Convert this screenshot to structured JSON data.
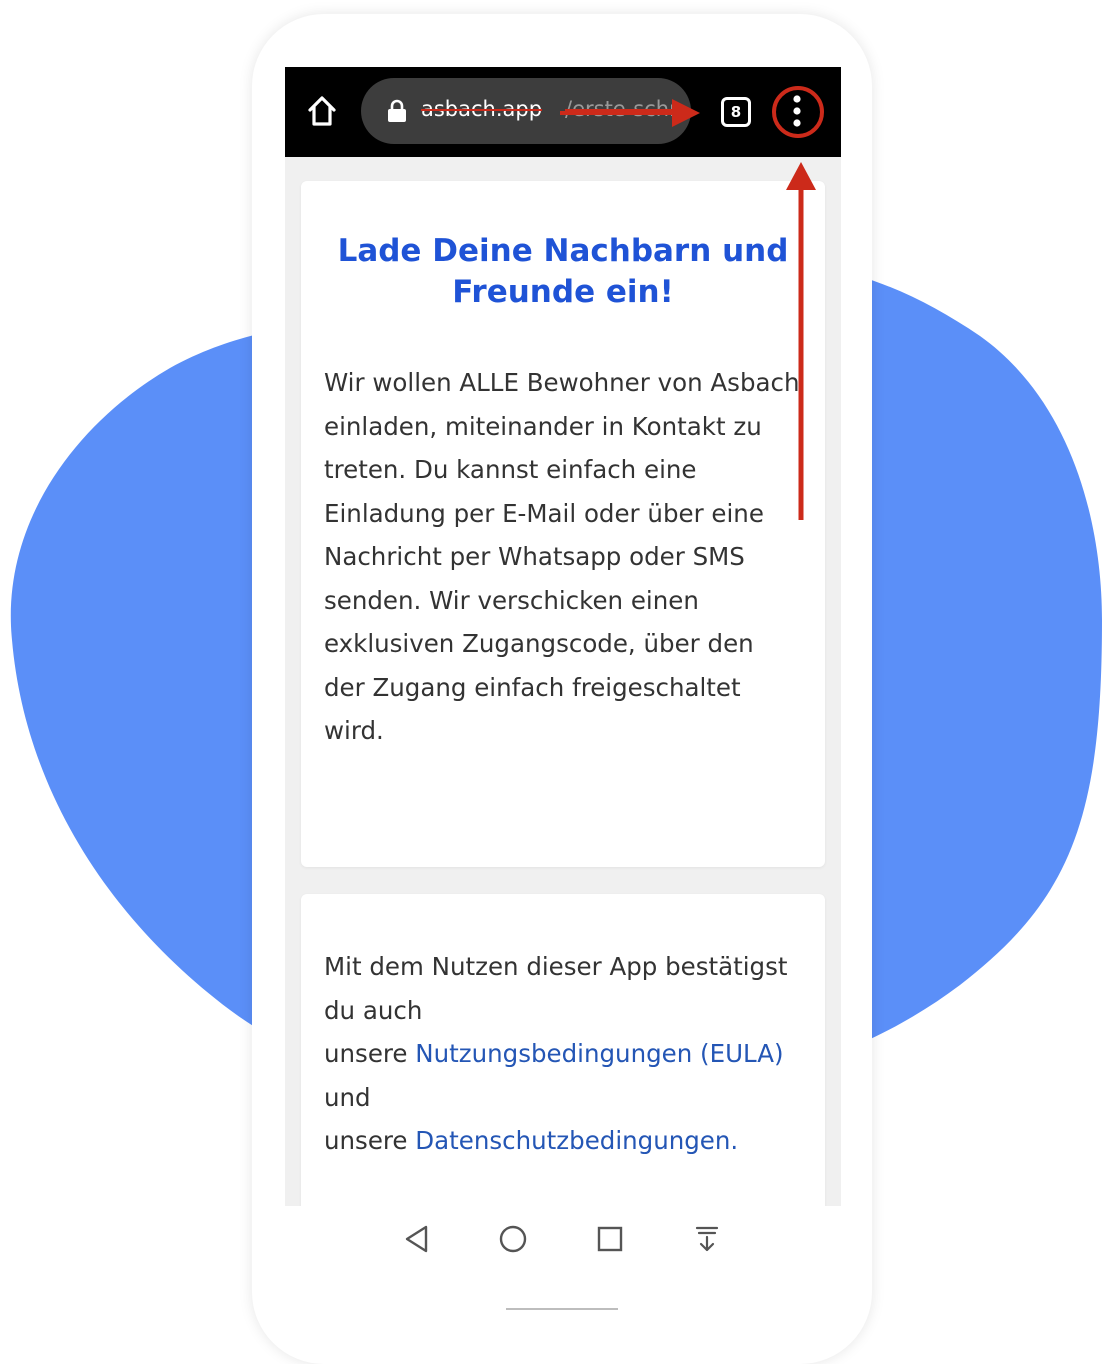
{
  "colors": {
    "blob": "#5b8ff8",
    "browser_bar": "#000000",
    "url_pill": "#3d3d3d",
    "title_blue": "#1f53d6",
    "link_blue": "#2456b5",
    "body_text": "#333333",
    "annotation_red": "#cc2a1a"
  },
  "browser": {
    "home_icon": "home-icon",
    "lock_icon": "lock-icon",
    "url_domain": "asbach.app",
    "url_path": "/erste-schr",
    "tab_count": "8",
    "menu_icon": "vertical-dots-icon"
  },
  "card_invite": {
    "title": "Lade Deine Nachbarn und Freunde ein!",
    "body": "Wir wollen ALLE Bewohner von Asbach einladen, miteinander in Kontakt zu treten. Du kannst einfach eine Einladung per E-Mail oder über eine Nachricht per Whatsapp oder SMS senden. Wir verschicken einen exklusiven Zugangscode, über den der Zugang einfach freigeschaltet wird."
  },
  "card_legal": {
    "intro": "Mit dem Nutzen dieser App bestätigst du auch",
    "prefix_1": "unsere ",
    "link_eula": "Nutzungsbedingungen (EULA)",
    "suffix_1": " und",
    "prefix_2": "unsere ",
    "link_privacy": "Datenschutzbedingungen.",
    "suffix_2": ""
  },
  "nav_bar": {
    "back_icon": "back-triangle-icon",
    "home_icon": "home-circle-icon",
    "recents_icon": "recents-square-icon",
    "extra_icon": "download-arrow-icon"
  },
  "annotations": {
    "arrow_right": "red-arrow-right-icon",
    "arrow_up": "red-arrow-up-icon",
    "highlight": "red-circle-highlight-icon"
  }
}
